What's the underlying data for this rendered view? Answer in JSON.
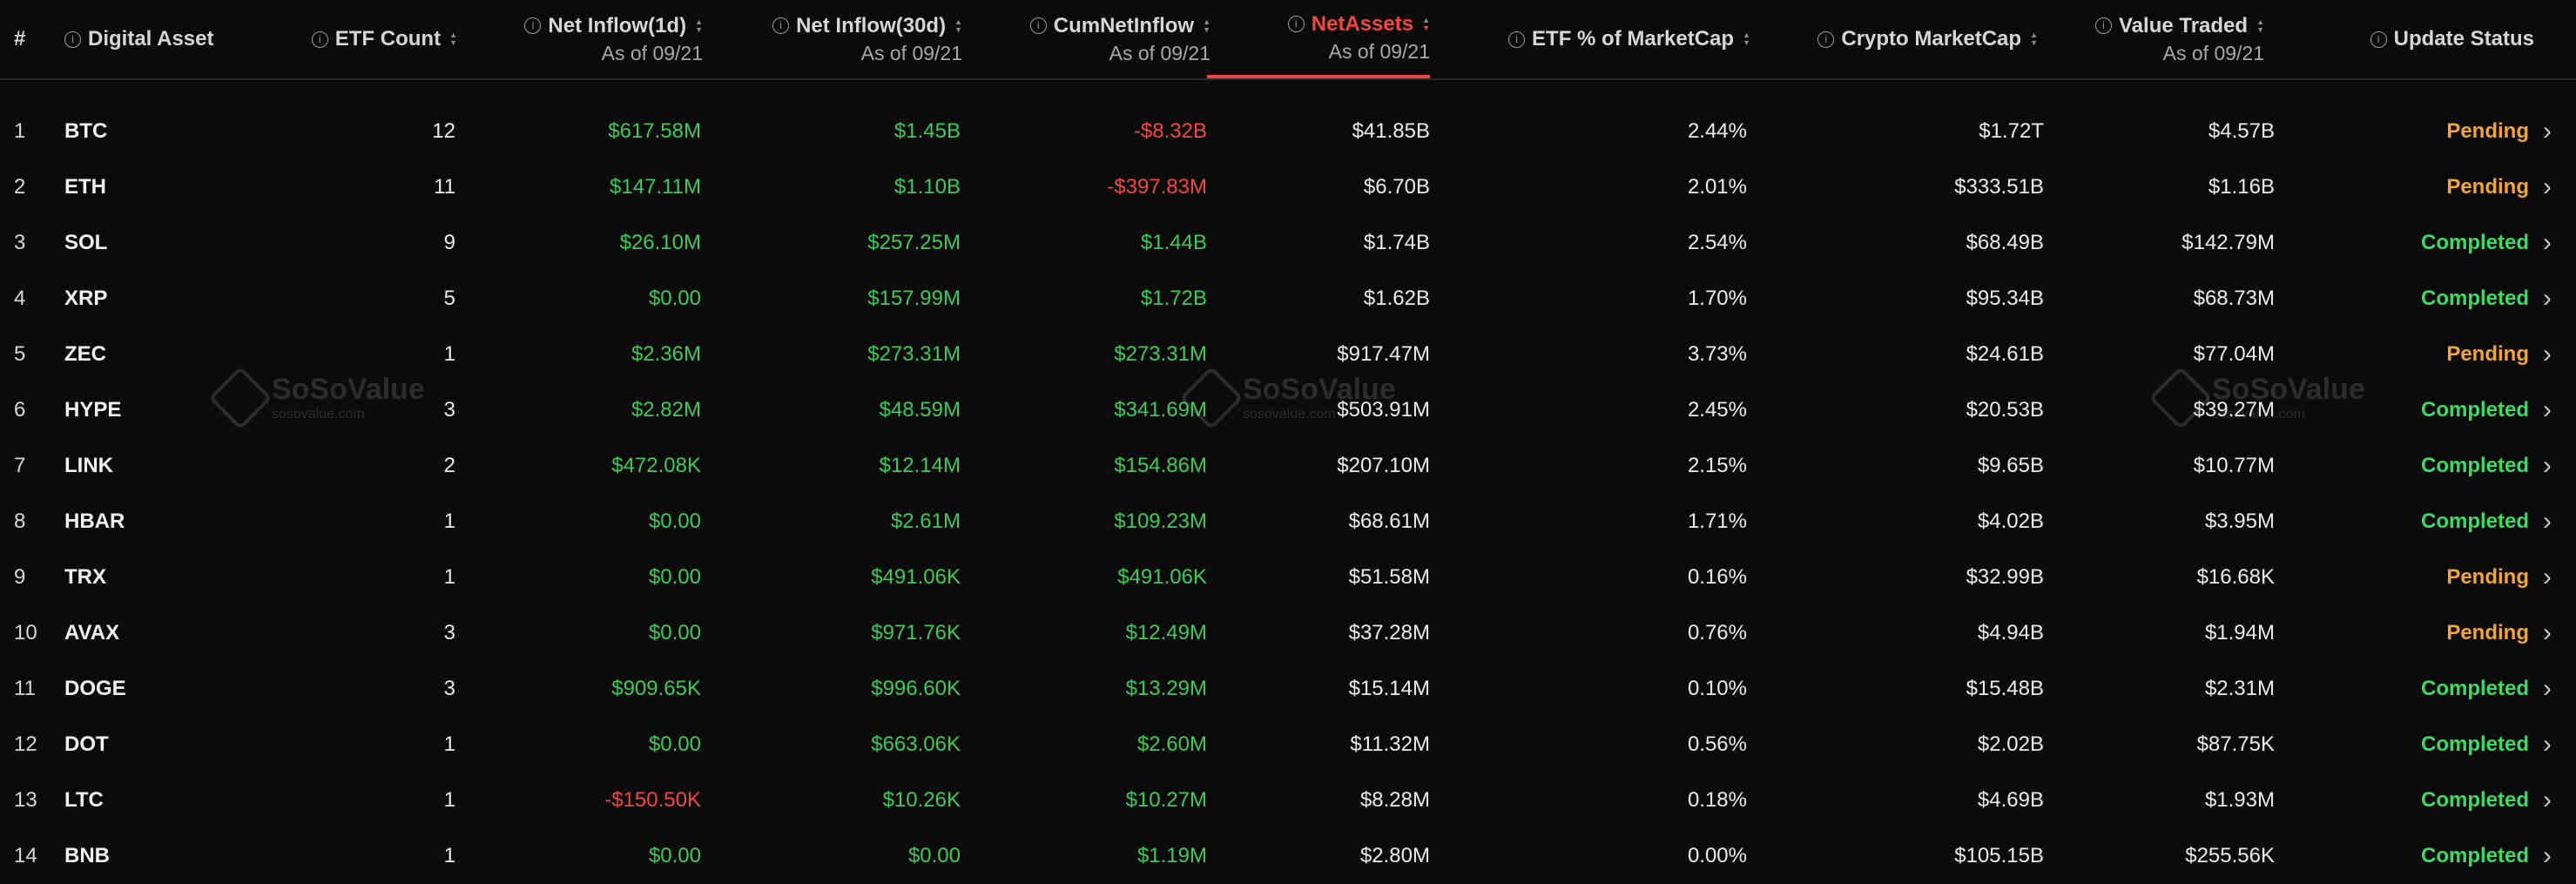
{
  "header": {
    "index": "#",
    "asset": "Digital Asset",
    "etf_count": "ETF Count",
    "inflow1d": "Net Inflow(1d)",
    "inflow30d": "Net Inflow(30d)",
    "cum": "CumNetInflow",
    "netassets": "NetAssets",
    "etf_pct": "ETF % of MarketCap",
    "mcap": "Crypto MarketCap",
    "traded": "Value Traded",
    "status": "Update Status",
    "as_of": "As of 09/21"
  },
  "watermark": {
    "name": "SoSoValue",
    "url": "sosovalue.com"
  },
  "rows": [
    {
      "n": "1",
      "asset": "BTC",
      "count": "12",
      "d1": "$617.58M",
      "d30": "$1.45B",
      "cum": "-$8.32B",
      "net": "$41.85B",
      "pct": "2.44%",
      "mcap": "$1.72T",
      "traded": "$4.57B",
      "status": "Pending"
    },
    {
      "n": "2",
      "asset": "ETH",
      "count": "11",
      "d1": "$147.11M",
      "d30": "$1.10B",
      "cum": "-$397.83M",
      "net": "$6.70B",
      "pct": "2.01%",
      "mcap": "$333.51B",
      "traded": "$1.16B",
      "status": "Pending"
    },
    {
      "n": "3",
      "asset": "SOL",
      "count": "9",
      "d1": "$26.10M",
      "d30": "$257.25M",
      "cum": "$1.44B",
      "net": "$1.74B",
      "pct": "2.54%",
      "mcap": "$68.49B",
      "traded": "$142.79M",
      "status": "Completed"
    },
    {
      "n": "4",
      "asset": "XRP",
      "count": "5",
      "d1": "$0.00",
      "d30": "$157.99M",
      "cum": "$1.72B",
      "net": "$1.62B",
      "pct": "1.70%",
      "mcap": "$95.34B",
      "traded": "$68.73M",
      "status": "Completed"
    },
    {
      "n": "5",
      "asset": "ZEC",
      "count": "1",
      "d1": "$2.36M",
      "d30": "$273.31M",
      "cum": "$273.31M",
      "net": "$917.47M",
      "pct": "3.73%",
      "mcap": "$24.61B",
      "traded": "$77.04M",
      "status": "Pending"
    },
    {
      "n": "6",
      "asset": "HYPE",
      "count": "3",
      "d1": "$2.82M",
      "d30": "$48.59M",
      "cum": "$341.69M",
      "net": "$503.91M",
      "pct": "2.45%",
      "mcap": "$20.53B",
      "traded": "$39.27M",
      "status": "Completed"
    },
    {
      "n": "7",
      "asset": "LINK",
      "count": "2",
      "d1": "$472.08K",
      "d30": "$12.14M",
      "cum": "$154.86M",
      "net": "$207.10M",
      "pct": "2.15%",
      "mcap": "$9.65B",
      "traded": "$10.77M",
      "status": "Completed"
    },
    {
      "n": "8",
      "asset": "HBAR",
      "count": "1",
      "d1": "$0.00",
      "d30": "$2.61M",
      "cum": "$109.23M",
      "net": "$68.61M",
      "pct": "1.71%",
      "mcap": "$4.02B",
      "traded": "$3.95M",
      "status": "Completed"
    },
    {
      "n": "9",
      "asset": "TRX",
      "count": "1",
      "d1": "$0.00",
      "d30": "$491.06K",
      "cum": "$491.06K",
      "net": "$51.58M",
      "pct": "0.16%",
      "mcap": "$32.99B",
      "traded": "$16.68K",
      "status": "Pending"
    },
    {
      "n": "10",
      "asset": "AVAX",
      "count": "3",
      "d1": "$0.00",
      "d30": "$971.76K",
      "cum": "$12.49M",
      "net": "$37.28M",
      "pct": "0.76%",
      "mcap": "$4.94B",
      "traded": "$1.94M",
      "status": "Pending"
    },
    {
      "n": "11",
      "asset": "DOGE",
      "count": "3",
      "d1": "$909.65K",
      "d30": "$996.60K",
      "cum": "$13.29M",
      "net": "$15.14M",
      "pct": "0.10%",
      "mcap": "$15.48B",
      "traded": "$2.31M",
      "status": "Completed"
    },
    {
      "n": "12",
      "asset": "DOT",
      "count": "1",
      "d1": "$0.00",
      "d30": "$663.06K",
      "cum": "$2.60M",
      "net": "$11.32M",
      "pct": "0.56%",
      "mcap": "$2.02B",
      "traded": "$87.75K",
      "status": "Completed"
    },
    {
      "n": "13",
      "asset": "LTC",
      "count": "1",
      "d1": "-$150.50K",
      "d30": "$10.26K",
      "cum": "$10.27M",
      "net": "$8.28M",
      "pct": "0.18%",
      "mcap": "$4.69B",
      "traded": "$1.93M",
      "status": "Completed"
    },
    {
      "n": "14",
      "asset": "BNB",
      "count": "1",
      "d1": "$0.00",
      "d30": "$0.00",
      "cum": "$1.19M",
      "net": "$2.80M",
      "pct": "0.00%",
      "mcap": "$105.15B",
      "traded": "$255.56K",
      "status": "Completed"
    }
  ]
}
